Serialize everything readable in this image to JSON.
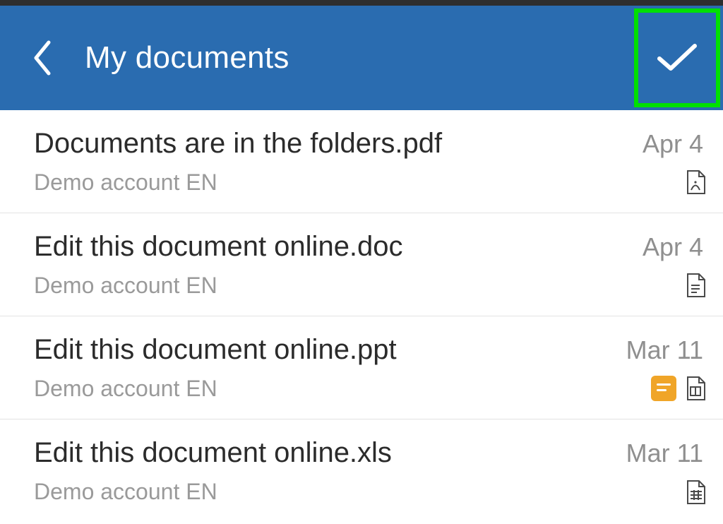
{
  "header": {
    "title": "My documents"
  },
  "items": [
    {
      "name": "Documents are in the folders.pdf",
      "subtitle": "Demo account EN",
      "date": "Apr 4",
      "type": "pdf",
      "has_note": false
    },
    {
      "name": "Edit this document online.doc",
      "subtitle": "Demo account EN",
      "date": "Apr 4",
      "type": "doc",
      "has_note": false
    },
    {
      "name": "Edit this document online.ppt",
      "subtitle": "Demo account EN",
      "date": "Mar 11",
      "type": "ppt",
      "has_note": true
    },
    {
      "name": "Edit this document online.xls",
      "subtitle": "Demo account EN",
      "date": "Mar 11",
      "type": "xls",
      "has_note": false
    }
  ]
}
